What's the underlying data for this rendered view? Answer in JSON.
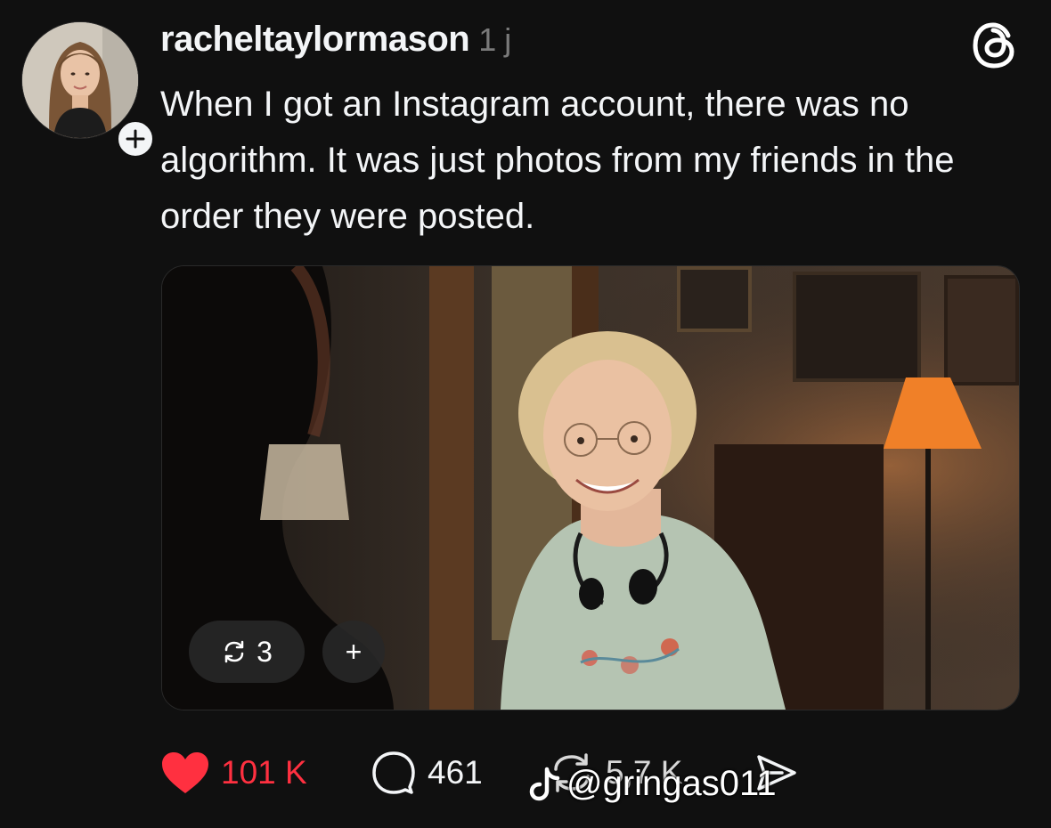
{
  "post": {
    "username": "racheltaylormason",
    "timestamp": "1 j",
    "text": "When I got an Instagram account, there was no algorithm. It was just photos from my friends in the order they were posted."
  },
  "media": {
    "repost_count": "3",
    "add_label": "+"
  },
  "actions": {
    "likes": "101 K",
    "comments": "461",
    "reposts": "5,7 K"
  },
  "watermark": {
    "handle": "@gringas011"
  },
  "colors": {
    "background": "#101010",
    "text": "#f3f5f7",
    "secondary": "#7a7a7a",
    "like_red": "#ff3040"
  },
  "icons": {
    "threads": "threads-logo-icon",
    "follow": "plus-icon",
    "like": "heart-filled-icon",
    "comment": "comment-bubble-icon",
    "repost": "repost-icon",
    "share": "send-icon",
    "tiktok": "tiktok-icon"
  }
}
